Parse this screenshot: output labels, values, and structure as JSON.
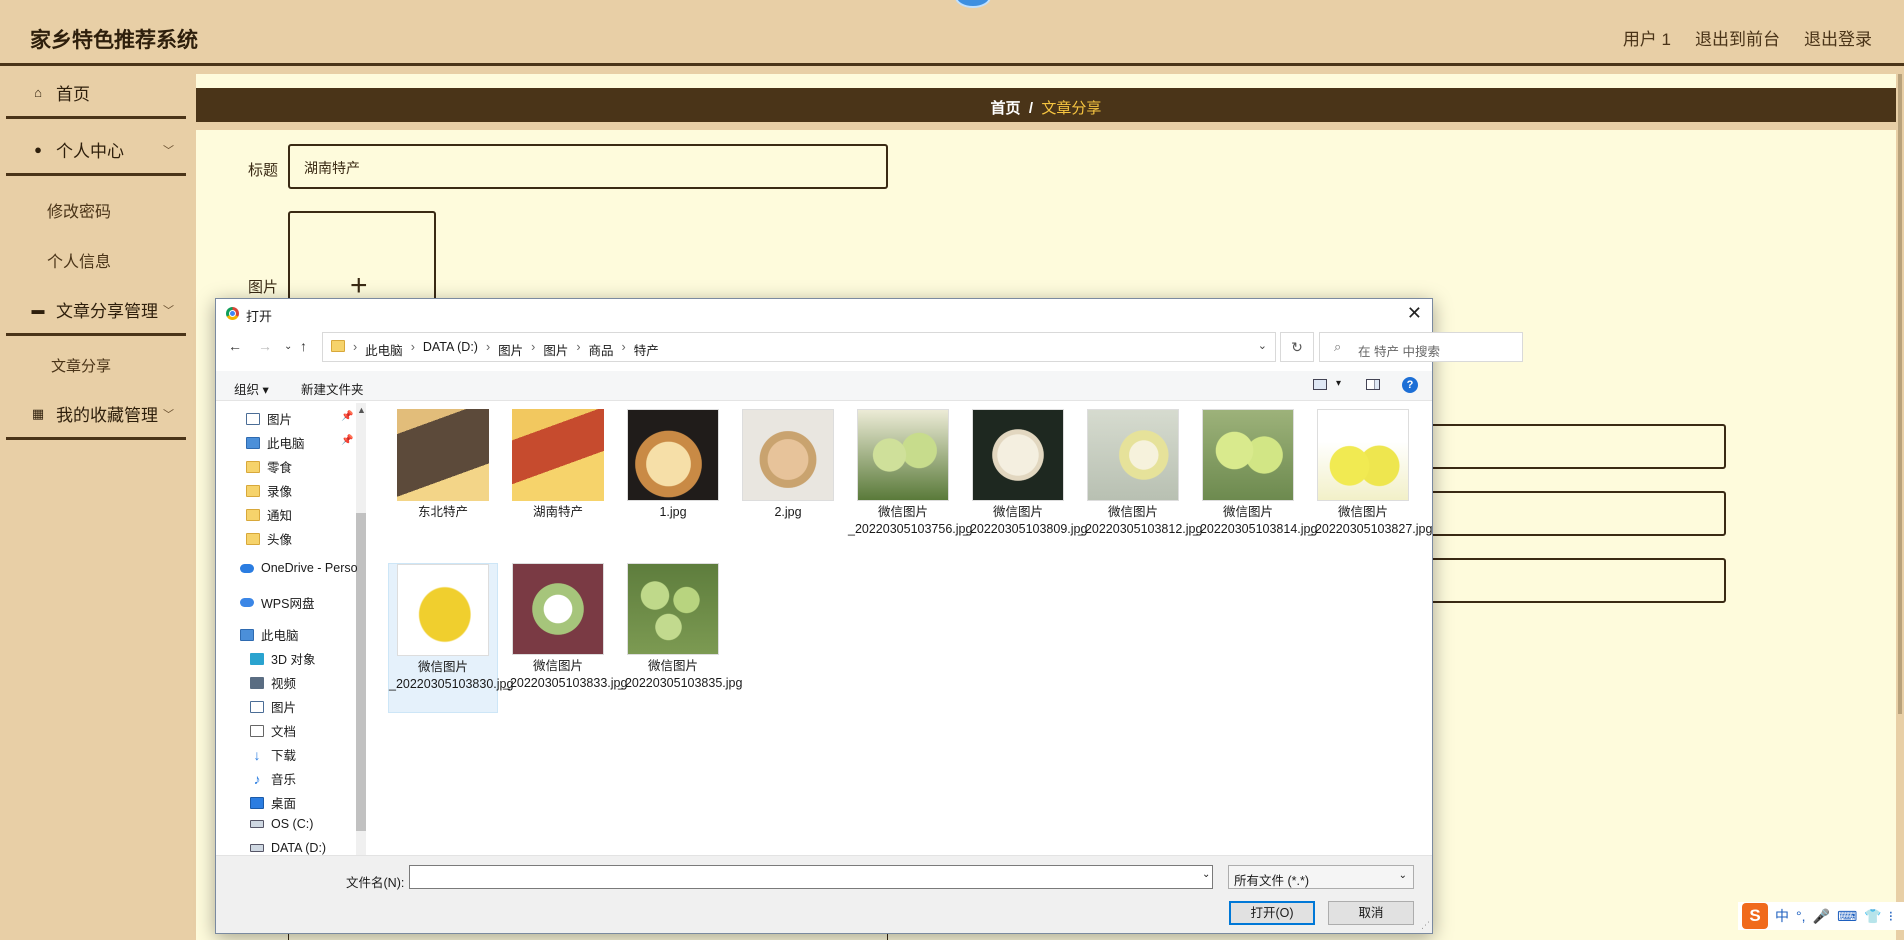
{
  "app": {
    "brand": "家乡特色推荐系统",
    "top_links": [
      "用户 1",
      "退出到前台",
      "退出登录"
    ]
  },
  "sidebar": {
    "items": [
      {
        "label": "首页",
        "icon": "home-icon"
      },
      {
        "label": "个人中心",
        "icon": "user-icon"
      },
      {
        "label": "文章分享管理",
        "icon": "monitor-icon"
      },
      {
        "label": "我的收藏管理",
        "icon": "grid-icon"
      }
    ],
    "sub_personal": [
      "修改密码",
      "个人信息"
    ],
    "sub_articles": [
      "文章分享"
    ]
  },
  "breadcrumb": {
    "home": "首页",
    "sep": "/",
    "current": "文章分享"
  },
  "form": {
    "title_label": "标题",
    "title_value": "湖南特产",
    "image_label": "图片",
    "upload_plus": "+"
  },
  "dialog": {
    "title": "打开",
    "close": "✕",
    "path": [
      "此电脑",
      "DATA (D:)",
      "图片",
      "图片",
      "商品",
      "特产"
    ],
    "search_placeholder": "在 特产 中搜索",
    "organize": "组织 ▾",
    "new_folder": "新建文件夹",
    "nav_pane": [
      {
        "label": "图片",
        "icon": "img"
      },
      {
        "label": "此电脑",
        "icon": "pc"
      },
      {
        "label": "零食",
        "icon": "folder"
      },
      {
        "label": "录像",
        "icon": "folder"
      },
      {
        "label": "通知",
        "icon": "folder"
      },
      {
        "label": "头像",
        "icon": "folder"
      },
      {
        "label": "OneDrive - Perso",
        "icon": "cloud"
      },
      {
        "label": "WPS网盘",
        "icon": "wps"
      },
      {
        "label": "此电脑",
        "icon": "pc"
      },
      {
        "label": "3D 对象",
        "icon": "cube"
      },
      {
        "label": "视频",
        "icon": "video"
      },
      {
        "label": "图片",
        "icon": "img"
      },
      {
        "label": "文档",
        "icon": "doc"
      },
      {
        "label": "下载",
        "icon": "down"
      },
      {
        "label": "音乐",
        "icon": "music"
      },
      {
        "label": "桌面",
        "icon": "desk"
      },
      {
        "label": "OS (C:)",
        "icon": "disk"
      },
      {
        "label": "DATA (D:)",
        "icon": "disk"
      }
    ],
    "files": [
      {
        "name": "东北特产",
        "kind": "folder"
      },
      {
        "name": "湖南特产",
        "kind": "folder"
      },
      {
        "name": "1.jpg",
        "kind": "image"
      },
      {
        "name": "2.jpg",
        "kind": "image"
      },
      {
        "name": "微信图片 _20220305103756.jpg",
        "kind": "image"
      },
      {
        "name": "微信图片 _20220305103809.jpg",
        "kind": "image"
      },
      {
        "name": "微信图片 _20220305103812.jpg",
        "kind": "image"
      },
      {
        "name": "微信图片 _20220305103814.jpg",
        "kind": "image"
      },
      {
        "name": "微信图片 _20220305103827.jpg",
        "kind": "image"
      },
      {
        "name": "微信图片 _20220305103830.jpg",
        "kind": "image",
        "selected": true
      },
      {
        "name": "微信图片 _20220305103833.jpg",
        "kind": "image"
      },
      {
        "name": "微信图片 _20220305103835.jpg",
        "kind": "image"
      }
    ],
    "filename_label": "文件名(N):",
    "filename_value": "",
    "filetype": "所有文件 (*.*)",
    "open_button": "打开(O)",
    "cancel_button": "取消"
  },
  "ime": {
    "logo": "S",
    "items": [
      "中",
      "°,",
      "🎤",
      "⌨",
      "👕",
      "⁝"
    ]
  }
}
